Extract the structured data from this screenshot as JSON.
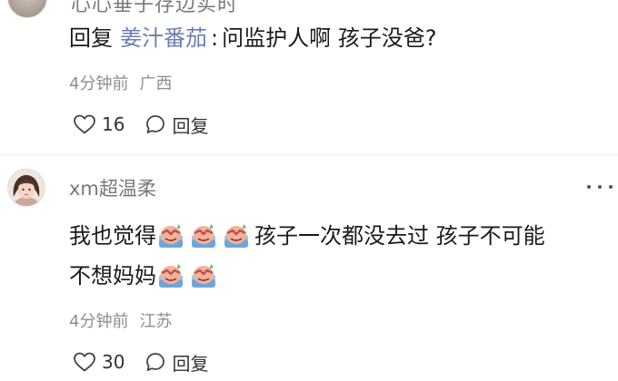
{
  "comment1": {
    "top_text": "心心垂子存边实时",
    "reply": {
      "keyword": "回复",
      "reply_to_user": "姜汁番茄",
      "separator": ":",
      "text": "问监护人啊 孩子没爸?"
    },
    "time": "4分钟前",
    "location": "广西",
    "likes": "16",
    "reply_label": "回复"
  },
  "comment2": {
    "username": "xm超温柔",
    "line1_prefix": "我也觉得",
    "line1_suffix": "孩子一次都没去过 孩子不可能",
    "line2_prefix": "不想妈妈",
    "emoji_name": "crying-face-emoji",
    "time": "4分钟前",
    "location": "江苏",
    "likes": "30",
    "reply_label": "回复"
  },
  "colors": {
    "username_link": "#6c7eb0",
    "meta_gray": "#8e8e8e",
    "text": "#1a1a1a"
  }
}
